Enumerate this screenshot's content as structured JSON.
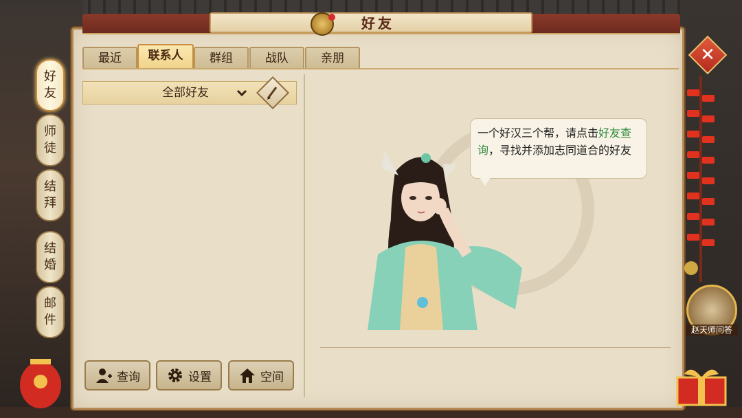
{
  "window": {
    "title": "好友"
  },
  "side_tabs": [
    {
      "chars": [
        "好",
        "友"
      ],
      "active": true
    },
    {
      "chars": [
        "师",
        "徒"
      ],
      "active": false
    },
    {
      "chars": [
        "结",
        "拜"
      ],
      "active": false
    },
    {
      "chars": [
        "结",
        "婚"
      ],
      "active": false
    },
    {
      "chars": [
        "邮",
        "件"
      ],
      "active": false
    }
  ],
  "tabs": [
    {
      "label": "最近",
      "active": false
    },
    {
      "label": "联系人",
      "active": true
    },
    {
      "label": "群组",
      "active": false
    },
    {
      "label": "战队",
      "active": false
    },
    {
      "label": "亲朋",
      "active": false
    }
  ],
  "filter": {
    "selected": "全部好友"
  },
  "buttons": {
    "query": "查询",
    "settings": "设置",
    "space": "空间"
  },
  "speech": {
    "part1": "一个好汉三个帮，请点击",
    "highlight": "好友查询",
    "part2": "，寻找并添加志同道合的好友"
  },
  "npc": {
    "label": "赵天师问答"
  },
  "colors": {
    "accent": "#c88e3c",
    "panel": "#e9dfc9",
    "highlight_text": "#2e8a3c",
    "close_red": "#b42a1e"
  },
  "icons": {
    "close": "close-icon",
    "edit": "brush-icon",
    "query": "add-user-icon",
    "settings": "gear-icon",
    "space": "home-icon"
  }
}
